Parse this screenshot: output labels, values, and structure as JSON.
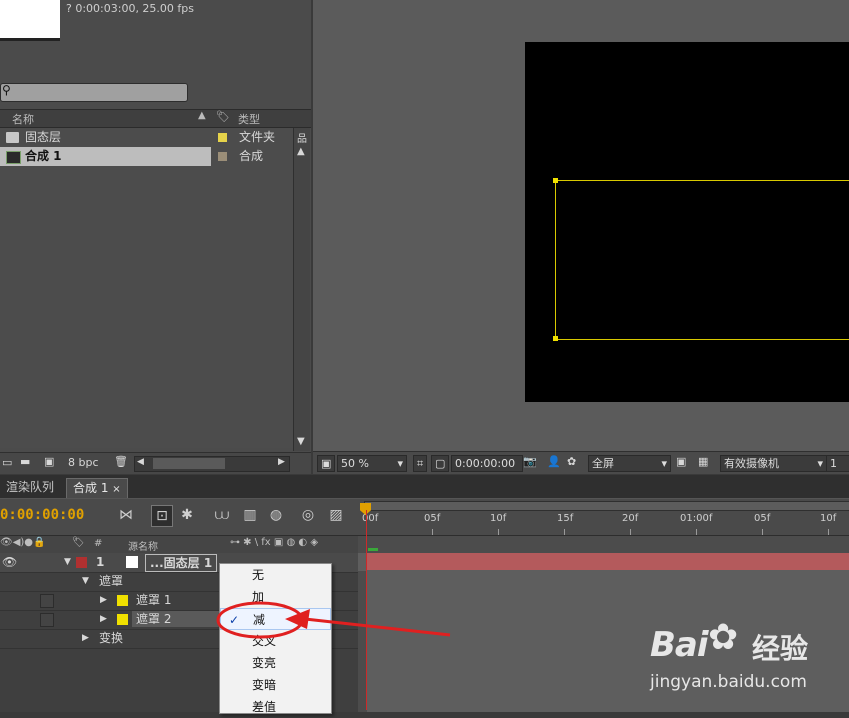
{
  "project": {
    "comp_info": "? 0:00:03:00, 25.00 fps",
    "columns": {
      "name": "名称",
      "type": "类型"
    },
    "items": [
      {
        "name": "固态层",
        "type": "文件夹",
        "swatch": "#e6d34a",
        "icon": "folder-icon"
      },
      {
        "name": "合成 1",
        "type": "合成",
        "swatch": "#9b8e78",
        "icon": "composition-icon"
      }
    ],
    "bpc": "8 bpc"
  },
  "viewer": {
    "zoom": "50 %",
    "timecode": "0:00:00:00",
    "resolution": "全屏",
    "camera": "有效摄像机",
    "views": "1"
  },
  "timeline": {
    "tabs": [
      {
        "label": "渲染队列"
      },
      {
        "label": "合成 1"
      }
    ],
    "current_time": "0:00:00:00",
    "ruler_labels": [
      "00f",
      "05f",
      "10f",
      "15f",
      "20f",
      "01:00f",
      "05f",
      "10f"
    ],
    "columns": {
      "number": "#",
      "source_name": "源名称"
    },
    "layers": [
      {
        "number": "1",
        "name": "...固态层 1",
        "label_color": "#b03030"
      }
    ],
    "groups": {
      "masks": "遮罩",
      "mask1": "遮罩 1",
      "mask2": "遮罩 2",
      "transform": "变换"
    }
  },
  "context_menu": {
    "items": [
      {
        "label": "无",
        "checked": false
      },
      {
        "label": "加",
        "checked": false
      },
      {
        "label": "减",
        "checked": true
      },
      {
        "label": "交叉",
        "checked": false
      },
      {
        "label": "变亮",
        "checked": false
      },
      {
        "label": "变暗",
        "checked": false
      },
      {
        "label": "差值",
        "checked": false
      }
    ],
    "check_mark": "✓"
  },
  "watermark": {
    "brand": "Bai",
    "brand_cn": "经验",
    "url": "jingyan.baidu.com"
  },
  "colors": {
    "accent": "#e0a000",
    "mask_outline": "#d8c900",
    "layer_bar": "#b45a5c",
    "annotation": "#e02020"
  }
}
